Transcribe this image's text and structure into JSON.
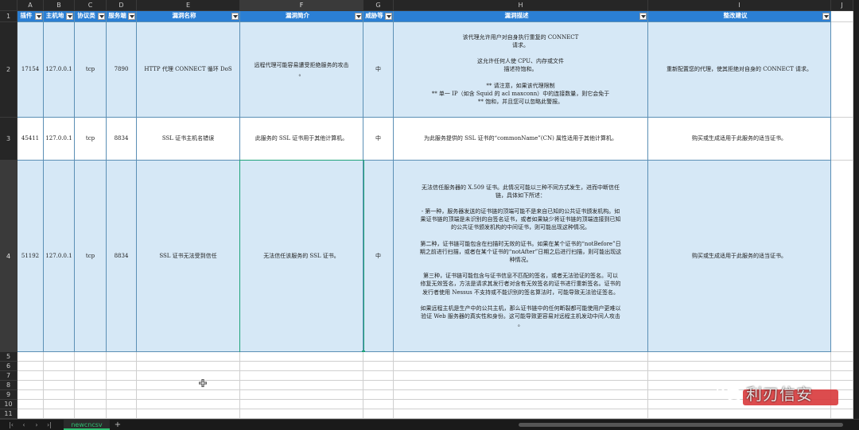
{
  "columns": [
    "A",
    "B",
    "C",
    "D",
    "E",
    "F",
    "G",
    "H",
    "I",
    "J"
  ],
  "selected_column": "F",
  "headers": [
    "插件",
    "主机地",
    "协议类",
    "服务端",
    "漏洞名称",
    "漏洞简介",
    "威胁等",
    "漏洞描述",
    "整改建议",
    ""
  ],
  "rows": [
    {
      "num": "2",
      "plugin": "17154",
      "host": "127.0.0.1",
      "proto": "tcp",
      "port": "7890",
      "name": "HTTP 代理 CONNECT 循环 DoS",
      "brief": "远程代理可能容易遭受拒绝服务的攻击\n。",
      "level": "中",
      "desc": "该代理允许用户对自身执行重复的 CONNECT\n请求。\n\n这允许任何人使 CPU、内存或文件\n描述符饱和。\n\n** 请注意，如果该代理限制\n** 单一 IP（如含 Squid 的 acl maxconn）中的连接数量，则它会免于\n** 饱和，并且您可以忽略此警报。",
      "fix": "重新配置您的代理，使其拒绝对自身的 CONNECT 请求。"
    },
    {
      "num": "3",
      "plugin": "45411",
      "host": "127.0.0.1",
      "proto": "tcp",
      "port": "8834",
      "name": "SSL 证书主机名错误",
      "brief": "此服务的 SSL 证书用于其他计算机。",
      "level": "中",
      "desc": "为此服务提供的 SSL 证书的“commonName”(CN) 属性适用于其他计算机。",
      "fix": "购买或生成适用于此服务的适当证书。"
    },
    {
      "num": "4",
      "plugin": "51192",
      "host": "127.0.0.1",
      "proto": "tcp",
      "port": "8834",
      "name": "SSL 证书无法受到信任",
      "brief": "无法信任该服务的 SSL 证书。",
      "level": "中",
      "desc": "无法信任服务器的 X.509 证书。此情况可能以三种不同方式发生，进而中断信任\n链，具体如下所述：\n\n- 第一种，服务器发送的证书链的顶端可能不是来自已知的公共证书颁发机构。如\n果证书链的顶端是未识别的自签名证书，或者如果缺少将证书链的顶端连接到已知\n的公共证书颁发机构的中间证书，则可能出现这种情况。\n\n第二种，证书链可能包含在扫描时无效的证书。如果在某个证书的“notBefore”日\n期之前进行扫描，或者在某个证书的“notAfter”日期之后进行扫描，则可能出现这\n种情况。\n\n第三种，证书链可能包含与证书信息不匹配的签名，或者无法验证的签名。可以\n修复无效签名，方法是请求其发行者对含有无效签名的证书进行重新签名。证书的\n发行者使用 Nessus 不支持或不能识别的签名算法时，可能导致无法验证签名。\n\n如果远程主机是生产中的公共主机，那么证书链中的任何断裂都可能使用户更难以\n验证 Web 服务器的真实性和身份。这可能导致更容易对远程主机发动中间人攻击\n。",
      "fix": "购买或生成适用于此服务的适当证书。"
    }
  ],
  "empty_rows": [
    "5",
    "6",
    "7",
    "8",
    "9",
    "10",
    "11"
  ],
  "sheet_tab": "newcncsv",
  "watermark": "利刃信安",
  "colors": {
    "header_blue": "#2b7fd4",
    "row_blue": "#d6e8f6",
    "selection": "#1fa37a",
    "tab_active": "#2fbf71"
  }
}
